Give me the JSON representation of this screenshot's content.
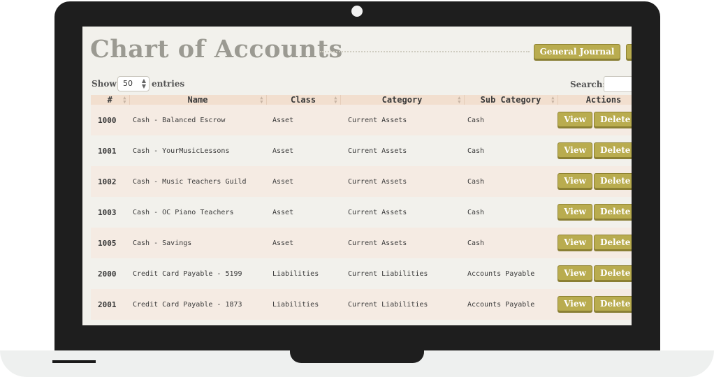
{
  "page": {
    "title": "Chart of Accounts",
    "journal_button": "General Journal",
    "extra_button": ""
  },
  "controls": {
    "show_label": "Show",
    "entries_value": "50",
    "entries_label": "entries",
    "search_label": "Search:",
    "search_value": ""
  },
  "table": {
    "headers": [
      "#",
      "Name",
      "Class",
      "Category",
      "Sub Category",
      "Actions"
    ],
    "rows": [
      {
        "num": "1000",
        "name": "Cash - Balanced Escrow",
        "class": "Asset",
        "category": "Current Assets",
        "sub": "Cash"
      },
      {
        "num": "1001",
        "name": "Cash - YourMusicLessons",
        "class": "Asset",
        "category": "Current Assets",
        "sub": "Cash"
      },
      {
        "num": "1002",
        "name": "Cash - Music Teachers Guild",
        "class": "Asset",
        "category": "Current Assets",
        "sub": "Cash"
      },
      {
        "num": "1003",
        "name": "Cash - OC Piano Teachers",
        "class": "Asset",
        "category": "Current Assets",
        "sub": "Cash"
      },
      {
        "num": "1005",
        "name": "Cash - Savings",
        "class": "Asset",
        "category": "Current Assets",
        "sub": "Cash"
      },
      {
        "num": "2000",
        "name": "Credit Card Payable - 5199",
        "class": "Liabilities",
        "category": "Current Liabilities",
        "sub": "Accounts Payable"
      },
      {
        "num": "2001",
        "name": "Credit Card Payable - 1873",
        "class": "Liabilities",
        "category": "Current Liabilities",
        "sub": "Accounts Payable"
      }
    ],
    "view_label": "View",
    "delete_label": "Delete"
  },
  "colors": {
    "button": "#b9ac4f",
    "title": "#9b9a92",
    "header_bg": "#f2dfcf",
    "row_odd": "#f5ebe3",
    "row_even": "#f2f1ec"
  },
  "icons": {
    "sort": "sort-arrows-icon",
    "select": "select-arrows-icon"
  }
}
